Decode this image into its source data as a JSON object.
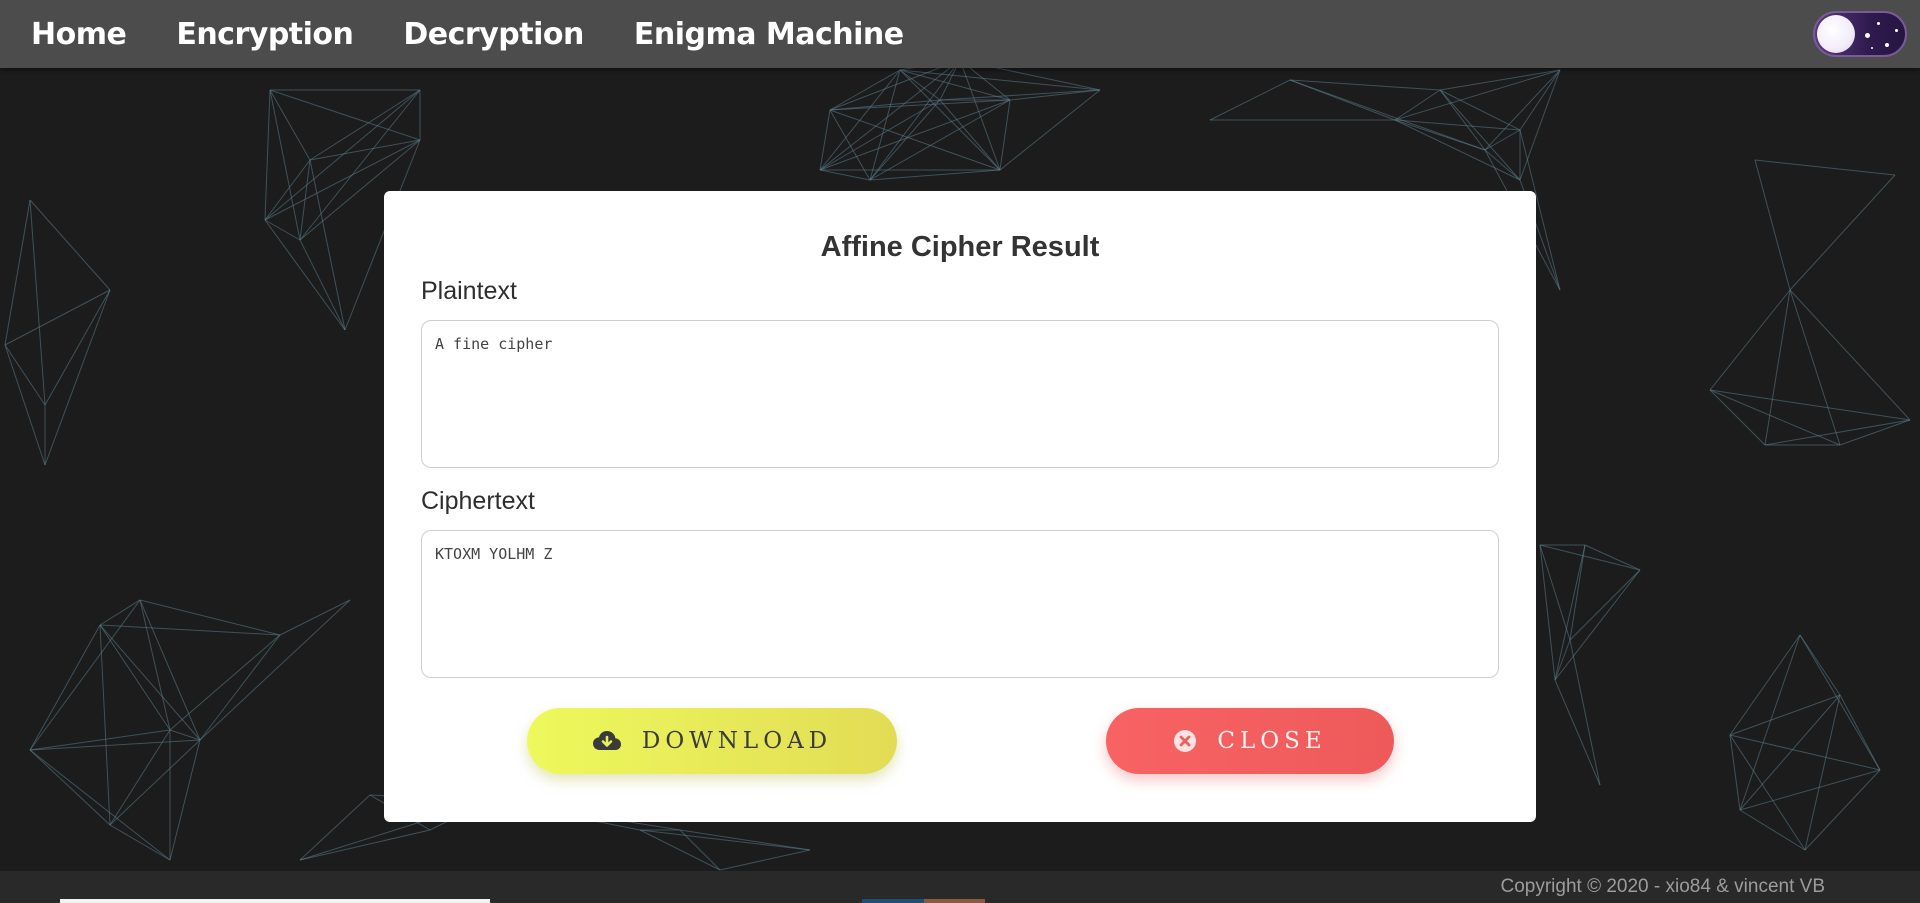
{
  "nav": {
    "links": [
      "Home",
      "Encryption",
      "Decryption",
      "Enigma Machine"
    ]
  },
  "modal": {
    "title": "Affine Cipher Result",
    "plaintext_label": "Plaintext",
    "plaintext_value": "A fine cipher",
    "ciphertext_label": "Ciphertext",
    "ciphertext_value": "KTOXM YOLHM Z",
    "download_label": "DOWNLOAD",
    "close_label": "CLOSE"
  },
  "footer": {
    "copyright": "Copyright © 2020 - xio84 & vincent VB"
  },
  "icons": {
    "download": "cloud-download-icon",
    "close": "times-circle-icon",
    "theme": "moon-toggle-icon"
  },
  "colors": {
    "navbar": "#4c4c4c",
    "background": "#1c1c1d",
    "download_button": "#edf95c",
    "close_button": "#f86262",
    "network_lines": "#5d7d88"
  }
}
